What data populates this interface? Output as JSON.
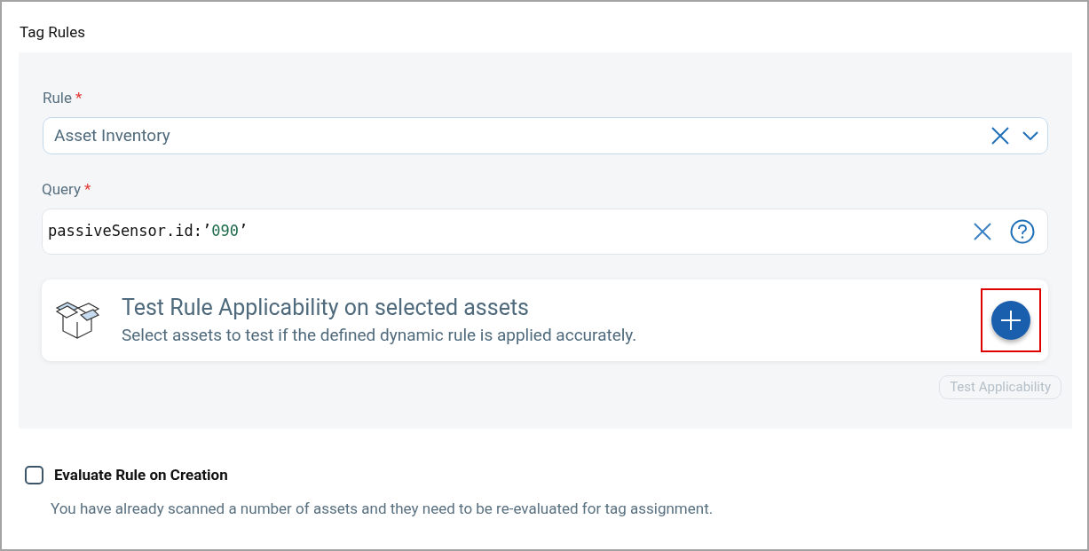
{
  "section_title": "Tag Rules",
  "rule": {
    "label": "Rule",
    "required_mark": "*",
    "value": "Asset Inventory"
  },
  "query": {
    "label": "Query",
    "required_mark": "*",
    "parts": [
      {
        "kind": "plain",
        "text": "passiveSensor.id:’"
      },
      {
        "kind": "string",
        "text": "090"
      },
      {
        "kind": "plain",
        "text": "’"
      }
    ]
  },
  "test_card": {
    "title": "Test Rule Applicability on selected assets",
    "subtitle": "Select assets to test if the defined dynamic rule is applied accurately.",
    "add_highlighted": true
  },
  "test_button": {
    "label": "Test Applicability",
    "disabled": true
  },
  "evaluate": {
    "label": "Evaluate Rule on Creation",
    "checked": false,
    "description": "You have already scanned a number of assets and they need to be re-evaluated for tag assignment."
  }
}
